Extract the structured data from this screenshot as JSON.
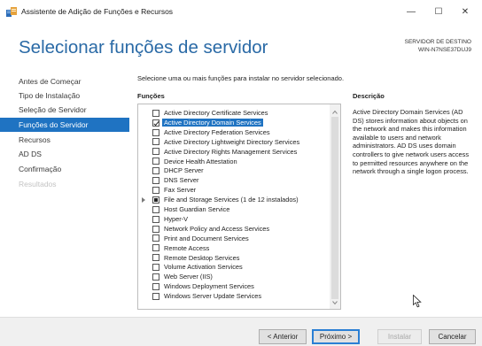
{
  "window": {
    "title": "Assistente de Adição de Funções e Recursos",
    "icon": "server-manager-icon",
    "controls": {
      "minimize": "—",
      "maximize": "☐",
      "close": "✕"
    }
  },
  "header": {
    "title": "Selecionar funções de servidor",
    "destination_label": "SERVIDOR DE DESTINO",
    "destination_host": "WIN-N7NSE37DUJ9"
  },
  "sidebar": {
    "items": [
      {
        "label": "Antes de Começar",
        "state": "normal"
      },
      {
        "label": "Tipo de Instalação",
        "state": "normal"
      },
      {
        "label": "Seleção de Servidor",
        "state": "normal"
      },
      {
        "label": "Funções do Servidor",
        "state": "active"
      },
      {
        "label": "Recursos",
        "state": "normal"
      },
      {
        "label": "AD DS",
        "state": "normal"
      },
      {
        "label": "Confirmação",
        "state": "normal"
      },
      {
        "label": "Resultados",
        "state": "disabled"
      }
    ]
  },
  "main": {
    "instruction": "Selecione uma ou mais funções para instalar no servidor selecionado.",
    "roles_header": "Funções",
    "description_header": "Descrição",
    "roles": [
      {
        "label": "Active Directory Certificate Services",
        "state": "unchecked"
      },
      {
        "label": "Active Directory Domain Services",
        "state": "checked",
        "selected": true
      },
      {
        "label": "Active Directory Federation Services",
        "state": "unchecked"
      },
      {
        "label": "Active Directory Lightweight Directory Services",
        "state": "unchecked"
      },
      {
        "label": "Active Directory Rights Management Services",
        "state": "unchecked"
      },
      {
        "label": "Device Health Attestation",
        "state": "unchecked"
      },
      {
        "label": "DHCP Server",
        "state": "unchecked"
      },
      {
        "label": "DNS Server",
        "state": "unchecked"
      },
      {
        "label": "Fax Server",
        "state": "unchecked"
      },
      {
        "label": "File and Storage Services (1 de 12 instalados)",
        "state": "partial",
        "expandable": true
      },
      {
        "label": "Host Guardian Service",
        "state": "unchecked"
      },
      {
        "label": "Hyper-V",
        "state": "unchecked"
      },
      {
        "label": "Network Policy and Access Services",
        "state": "unchecked"
      },
      {
        "label": "Print and Document Services",
        "state": "unchecked"
      },
      {
        "label": "Remote Access",
        "state": "unchecked"
      },
      {
        "label": "Remote Desktop Services",
        "state": "unchecked"
      },
      {
        "label": "Volume Activation Services",
        "state": "unchecked"
      },
      {
        "label": "Web Server (IIS)",
        "state": "unchecked"
      },
      {
        "label": "Windows Deployment Services",
        "state": "unchecked"
      },
      {
        "label": "Windows Server Update Services",
        "state": "unchecked"
      }
    ],
    "description": "Active Directory Domain Services (AD DS) stores information about objects on the network and makes this information available to users and network administrators. AD DS uses domain controllers to give network users access to permitted resources anywhere on the network through a single logon process."
  },
  "footer": {
    "previous": "< Anterior",
    "next": "Próximo >",
    "install": "Instalar",
    "cancel": "Cancelar"
  },
  "colors": {
    "accent": "#1f73c2",
    "heading": "#2a6aa6",
    "disabled_text": "#c3c3c3"
  }
}
